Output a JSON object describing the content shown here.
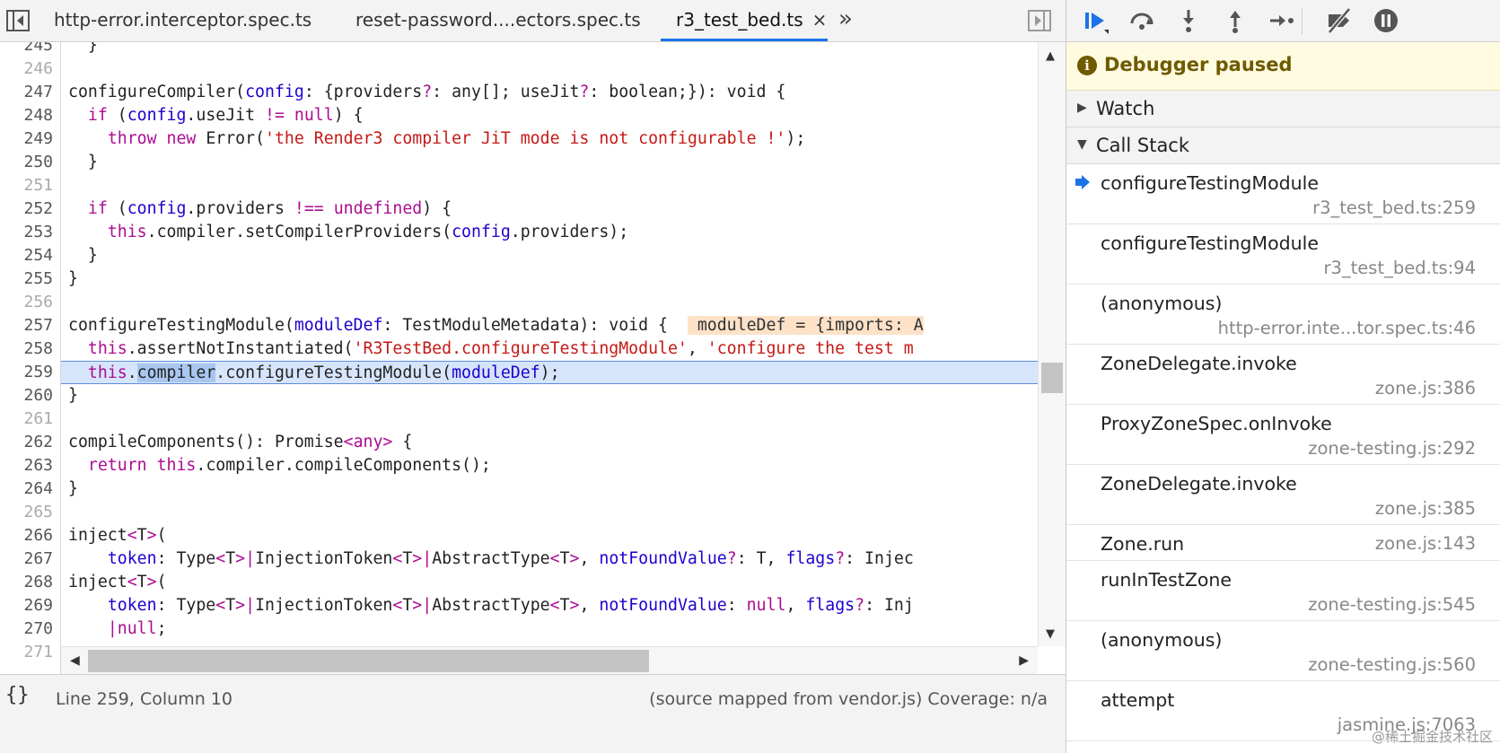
{
  "editor": {
    "tabs": [
      {
        "label": "http-error.interceptor.spec.ts"
      },
      {
        "label": "reset-password....ectors.spec.ts"
      },
      {
        "label": "r3_test_bed.ts",
        "close": "×"
      }
    ],
    "more_tabs": "»",
    "line_numbers": [
      "245",
      "246",
      "247",
      "248",
      "249",
      "250",
      "251",
      "252",
      "253",
      "254",
      "255",
      "256",
      "257",
      "258",
      "259",
      "260",
      "261",
      "262",
      "263",
      "264",
      "265",
      "266",
      "267",
      "268",
      "269",
      "270",
      "271"
    ],
    "code": {
      "l245": "}",
      "l247a": "configureCompiler(",
      "l247b": "config",
      "l247c": ": {providers",
      "l247d": "?",
      "l247e": ": any[]; useJit",
      "l247f": "?",
      "l247g": ": boolean;}): void {",
      "l248a": "if",
      "l248b": " (",
      "l248c": "config",
      "l248d": ".useJit ",
      "l248e": "!=",
      "l248f": " ",
      "l248g": "null",
      "l248h": ") {",
      "l249a": "throw",
      "l249b": " ",
      "l249c": "new",
      "l249d": " Error(",
      "l249e": "'the Render3 compiler JiT mode is not configurable !'",
      "l249f": ");",
      "l250": "}",
      "l252a": "if",
      "l252b": " (",
      "l252c": "config",
      "l252d": ".providers ",
      "l252e": "!==",
      "l252f": " ",
      "l252g": "undefined",
      "l252h": ") {",
      "l253a": "this",
      "l253b": ".compiler.setCompilerProviders(",
      "l253c": "config",
      "l253d": ".providers);",
      "l254": "}",
      "l255": "}",
      "l257a": "configureTestingModule(",
      "l257b": "moduleDef",
      "l257c": ": TestModuleMetadata): void {",
      "l257d": " moduleDef = {imports: A",
      "l258a": "this",
      "l258b": ".assertNotInstantiated(",
      "l258c": "'R3TestBed.configureTestingModule'",
      "l258d": ", ",
      "l258e": "'configure the test m",
      "l259a": "this",
      "l259b": ".",
      "l259c": "compiler",
      "l259d": ".configureTestingModule(",
      "l259e": "moduleDef",
      "l259f": ");",
      "l260": "}",
      "l262a": "compileComponents(): Promise",
      "l262b": "<",
      "l262c": "any",
      "l262d": ">",
      "l262e": " {",
      "l263a": "return",
      "l263b": " ",
      "l263c": "this",
      "l263d": ".compiler.compileComponents();",
      "l264": "}",
      "l266a": "inject",
      "l266b": "<",
      "l266c": "T",
      "l266d": ">",
      "l266e": "(",
      "l267a": "token",
      "l267b": ": Type",
      "l267c": "<",
      "l267d": "T",
      "l267e": ">|",
      "l267f": "InjectionToken",
      "l267g": "<",
      "l267h": "T",
      "l267i": ">|",
      "l267j": "AbstractType",
      "l267k": "<",
      "l267l": "T",
      "l267m": ">",
      "l267n": ", ",
      "l267o": "notFoundValue",
      "l267p": "?",
      "l267q": ": T, ",
      "l267r": "flags",
      "l267s": "?",
      "l267t": ": Injec",
      "l268a": "inject",
      "l268b": "<",
      "l268c": "T",
      "l268d": ">",
      "l268e": "(",
      "l269a": "token",
      "l269b": ": Type",
      "l269c": "<",
      "l269d": "T",
      "l269e": ">|",
      "l269f": "InjectionToken",
      "l269g": "<",
      "l269h": "T",
      "l269i": ">|",
      "l269j": "AbstractType",
      "l269k": "<",
      "l269l": "T",
      "l269m": ">",
      "l269n": ", ",
      "l269o": "notFoundValue",
      "l269p": ": ",
      "l269q": "null",
      "l269r": ", ",
      "l269s": "flags",
      "l269t": "?",
      "l269u": ": Inj",
      "l270a": "|",
      "l270b": "null",
      "l270c": ";"
    },
    "status": {
      "pretty_print": "{}",
      "cursor": "Line 259, Column 10",
      "right": "(source mapped from vendor.js)  Coverage: n/a"
    }
  },
  "debugger": {
    "paused_icon": "i",
    "paused_label": "Debugger paused",
    "watch_label": "Watch",
    "callstack_label": "Call Stack",
    "frames": [
      {
        "fn": "configureTestingModule",
        "loc": "r3_test_bed.ts:259"
      },
      {
        "fn": "configureTestingModule",
        "loc": "r3_test_bed.ts:94"
      },
      {
        "fn": "(anonymous)",
        "loc": "http-error.inte...tor.spec.ts:46"
      },
      {
        "fn": "ZoneDelegate.invoke",
        "loc": "zone.js:386"
      },
      {
        "fn": "ProxyZoneSpec.onInvoke",
        "loc": "zone-testing.js:292"
      },
      {
        "fn": "ZoneDelegate.invoke",
        "loc": "zone.js:385"
      },
      {
        "fn": "Zone.run",
        "loc": "zone.js:143"
      },
      {
        "fn": "runInTestZone",
        "loc": "zone-testing.js:545"
      },
      {
        "fn": "(anonymous)",
        "loc": "zone-testing.js:560"
      },
      {
        "fn": "attempt",
        "loc": "jasmine.js:7063"
      }
    ]
  },
  "watermark": "@稀土掘金技术社区",
  "colors": {
    "accent": "#1a73e8",
    "keyword": "#aa0d91",
    "string": "#c41a16",
    "param": "#1c00cf",
    "exec_line": "#d6e5fb",
    "paused_banner": "#fffbe1"
  },
  "icons": [
    "toggle-navigator-icon",
    "toggle-debugger-icon",
    "resume-icon",
    "step-over-icon",
    "step-into-icon",
    "step-out-icon",
    "step-icon",
    "deactivate-breakpoints-icon",
    "pause-on-exceptions-icon",
    "current-frame-arrow-icon"
  ]
}
